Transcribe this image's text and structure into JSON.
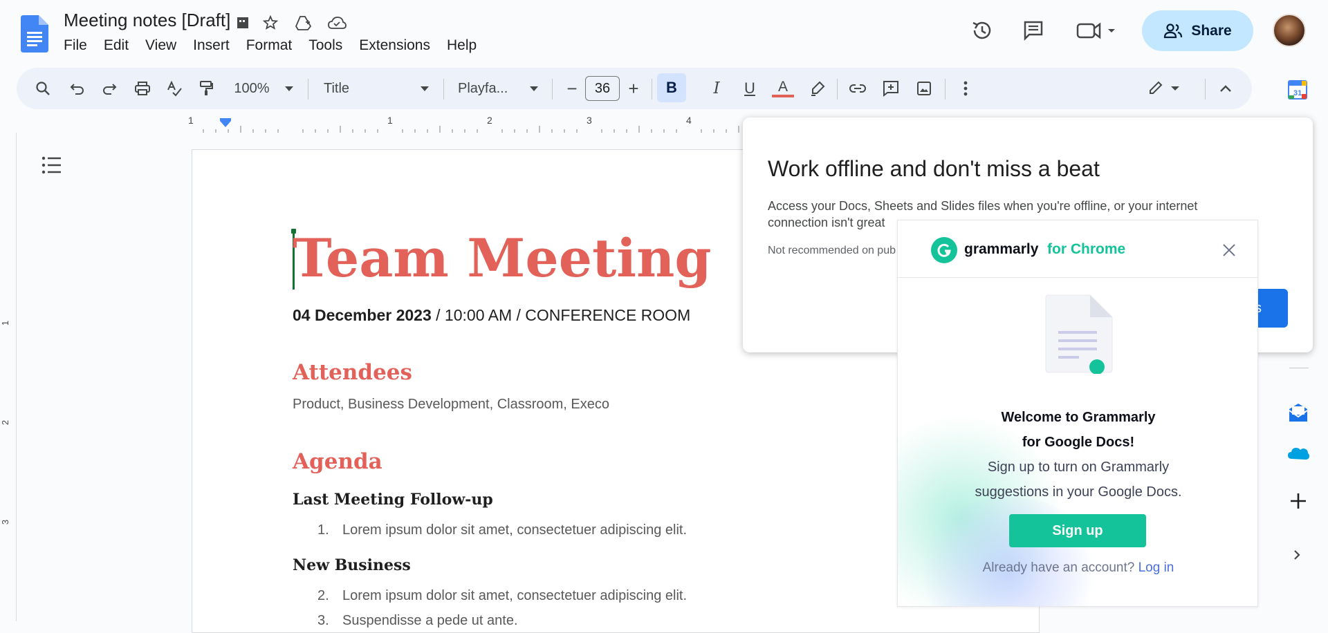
{
  "header": {
    "title": "Meeting notes [Draft]",
    "menu": [
      "File",
      "Edit",
      "View",
      "Insert",
      "Format",
      "Tools",
      "Extensions",
      "Help"
    ],
    "share_label": "Share"
  },
  "toolbar": {
    "zoom": "100%",
    "style": "Title",
    "font": "Playfa...",
    "font_size": "36",
    "bold": "B",
    "italic": "I",
    "underline": "U",
    "text_color": "A",
    "minus": "−",
    "plus": "+"
  },
  "ruler": {
    "labels": [
      "1",
      "1",
      "2",
      "3",
      "4"
    ],
    "vlabels": [
      "1",
      "2",
      "3"
    ]
  },
  "document": {
    "title": "Team Meeting",
    "date_bold": "04 December 2023",
    "date_rest": " / 10:00 AM / CONFERENCE ROOM",
    "attendees_heading": "Attendees",
    "attendees_text": "Product, Business Development, Classroom, Execo",
    "agenda_heading": "Agenda",
    "sub1": "Last Meeting Follow-up",
    "item1_num": "1.",
    "item1": "Lorem ipsum dolor sit amet, consectetuer adipiscing elit.",
    "sub2": "New Business",
    "item2_num": "2.",
    "item2": "Lorem ipsum dolor sit amet, consectetuer adipiscing elit.",
    "item3_num": "3.",
    "item3": "Suspendisse a pede ut ante."
  },
  "offline_popup": {
    "title": "Work offline and don't miss a beat",
    "body": "Access your Docs, Sheets and Slides files when you're offline, or your internet connection isn't great",
    "note": "Not recommended on pub",
    "button_fragment": "s"
  },
  "grammarly": {
    "brand": "grammarly",
    "for_chrome": "for Chrome",
    "welcome_line1": "Welcome to Grammarly",
    "welcome_line2": "for Google Docs!",
    "body_line1": "Sign up to turn on Grammarly",
    "body_line2": "suggestions in your Google Docs.",
    "signup": "Sign up",
    "already": "Already have an account?",
    "login": "Log in"
  },
  "colors": {
    "accent_red": "#e2625a",
    "grammarly_green": "#15c39a",
    "docs_blue": "#4285f4"
  }
}
